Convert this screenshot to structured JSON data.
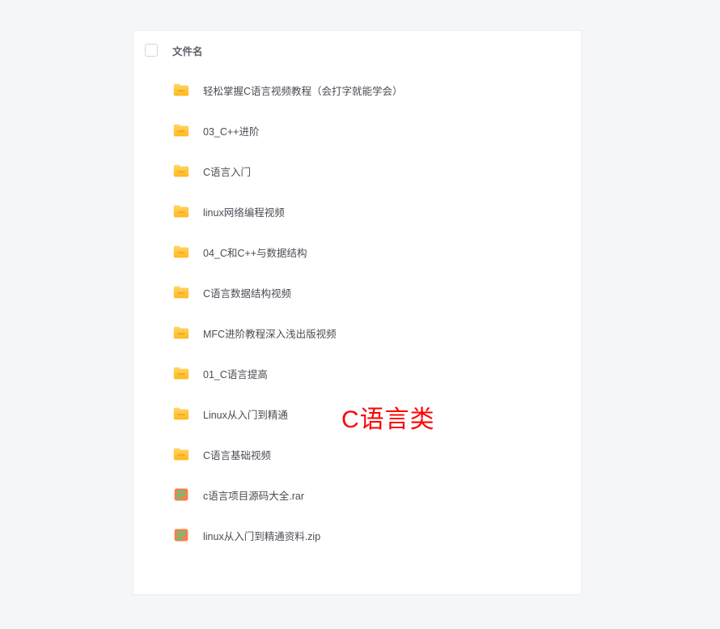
{
  "header": {
    "column_title": "文件名"
  },
  "files": [
    {
      "name": "轻松掌握C语言视频教程（会打字就能学会）",
      "type": "folder"
    },
    {
      "name": "03_C++进阶",
      "type": "folder"
    },
    {
      "name": "C语言入门",
      "type": "folder"
    },
    {
      "name": "linux网络编程视频",
      "type": "folder"
    },
    {
      "name": "04_C和C++与数据结构",
      "type": "folder"
    },
    {
      "name": "C语言数据结构视频",
      "type": "folder"
    },
    {
      "name": "MFC进阶教程深入浅出版视频",
      "type": "folder"
    },
    {
      "name": "01_C语言提高",
      "type": "folder"
    },
    {
      "name": "Linux从入门到精通",
      "type": "folder"
    },
    {
      "name": "C语言基础视频",
      "type": "folder"
    },
    {
      "name": "c语言项目源码大全.rar",
      "type": "archive"
    },
    {
      "name": "linux从入门到精通资料.zip",
      "type": "archive"
    }
  ],
  "overlay": {
    "label": "C语言类"
  }
}
